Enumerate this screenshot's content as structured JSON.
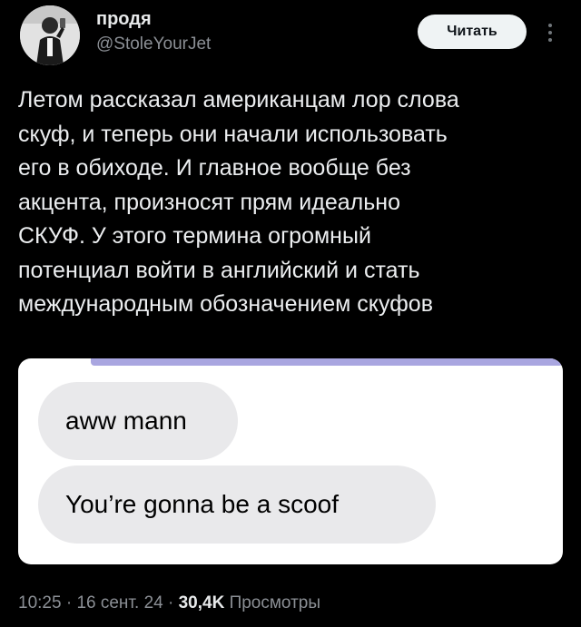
{
  "author": {
    "name": "продя",
    "handle": "@StoleYourJet"
  },
  "follow_label": "Читать",
  "tweet": {
    "text": "Летом рассказал американцам лор слова\nскуф, и теперь они начали использовать\nего в обиходе. И главное вообще без\nакцента, произносят прям идеально\nСКУФ. У этого термина огромный\nпотенциал войти в английский и стать\nмеждународным обозначением скуфов"
  },
  "media": {
    "messages": [
      "aww mann",
      "You’re gonna be a scoof"
    ]
  },
  "meta": {
    "time": "10:25",
    "separator": " · ",
    "date": "16 сент. 24",
    "views_count": "30,4K",
    "views_label": "Просмотры"
  },
  "colors": {
    "background": "#000000",
    "follow_button": "#eff3f4",
    "bubble": "#e9e9eb",
    "secondary_text": "#8b8f95"
  },
  "icons": [
    "avatar",
    "more-vertical-icon"
  ]
}
